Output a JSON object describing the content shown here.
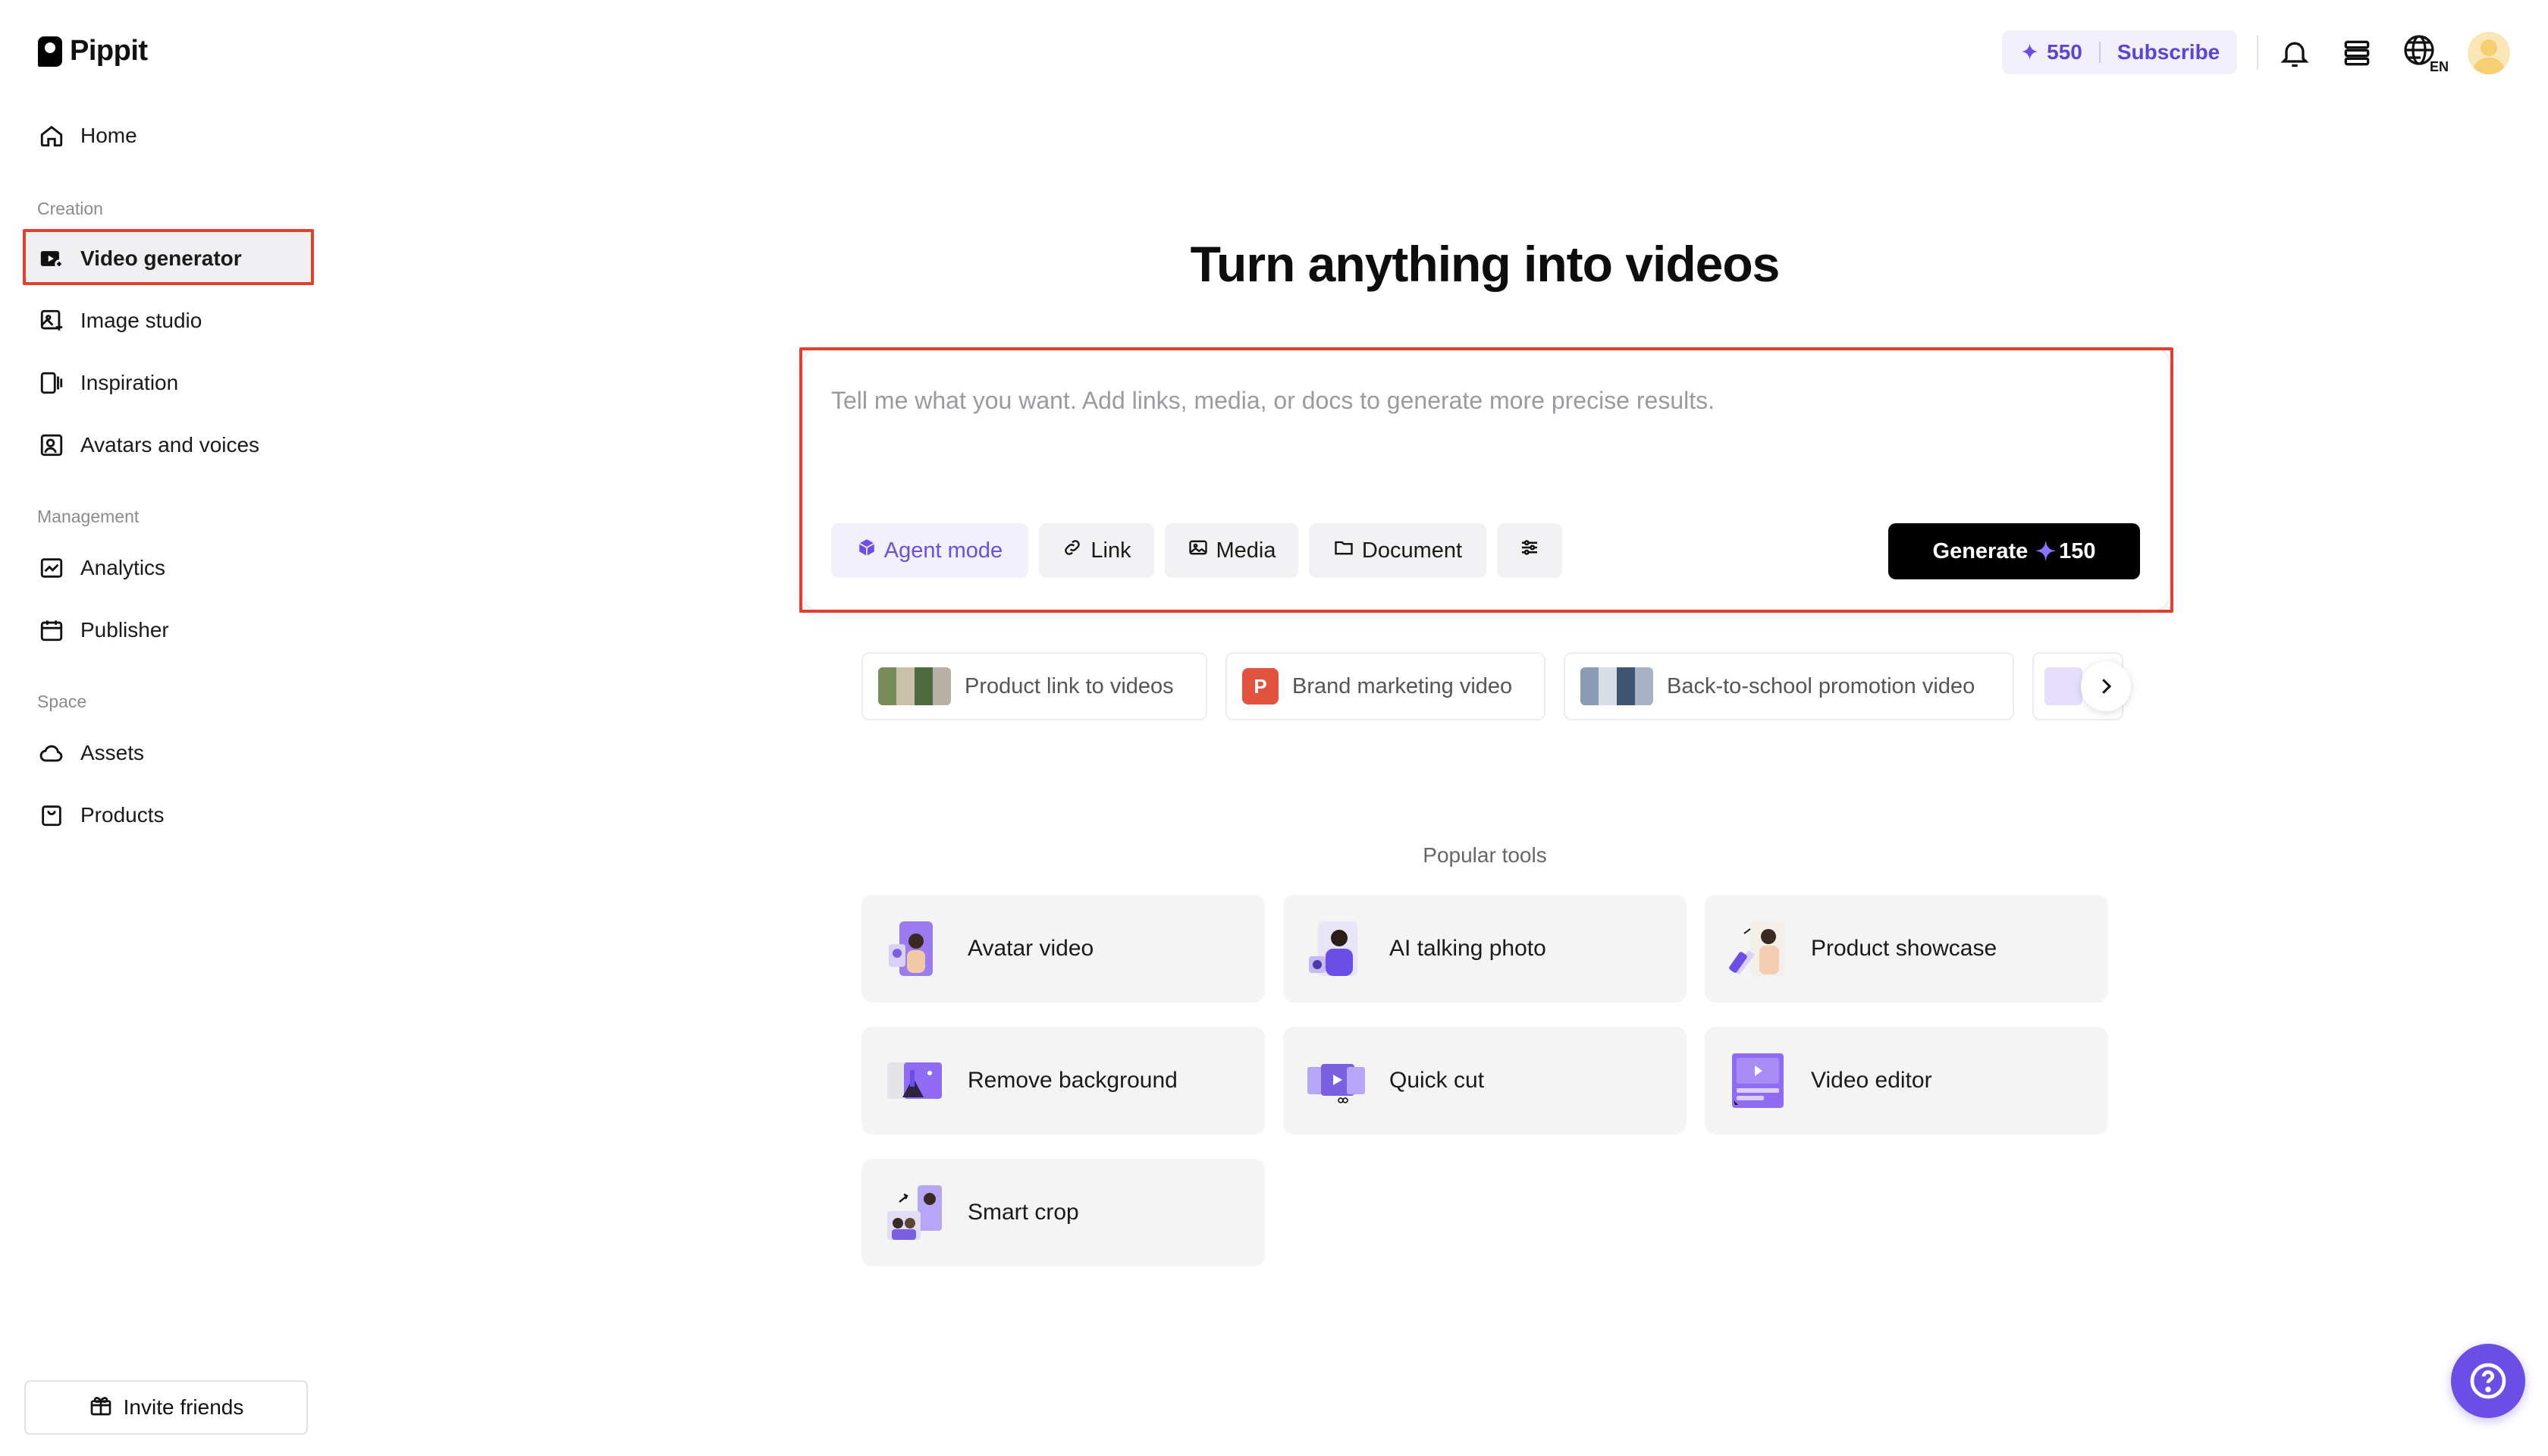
{
  "brand": {
    "name": "Pippit"
  },
  "sidebar": {
    "home": "Home",
    "sections": {
      "creation": "Creation",
      "management": "Management",
      "space": "Space"
    },
    "creation_items": [
      {
        "label": "Video generator",
        "icon": "video-plus-icon"
      },
      {
        "label": "Image studio",
        "icon": "image-plus-icon"
      },
      {
        "label": "Inspiration",
        "icon": "inspiration-icon"
      },
      {
        "label": "Avatars and voices",
        "icon": "avatar-voice-icon"
      }
    ],
    "management_items": [
      {
        "label": "Analytics",
        "icon": "analytics-icon"
      },
      {
        "label": "Publisher",
        "icon": "calendar-icon"
      }
    ],
    "space_items": [
      {
        "label": "Assets",
        "icon": "cloud-icon"
      },
      {
        "label": "Products",
        "icon": "product-box-icon"
      }
    ],
    "invite": "Invite friends"
  },
  "topbar": {
    "credits": "550",
    "subscribe": "Subscribe",
    "language": "EN"
  },
  "hero": {
    "title": "Turn anything into videos",
    "placeholder": "Tell me what you want. Add links, media, or docs to generate more precise results.",
    "chips": {
      "agent": "Agent mode",
      "link": "Link",
      "media": "Media",
      "document": "Document"
    },
    "generate": "Generate",
    "generate_cost": "150"
  },
  "suggestions": [
    {
      "label": "Product link to videos"
    },
    {
      "label": "Brand marketing video",
      "badge": "P"
    },
    {
      "label": "Back-to-school promotion video"
    }
  ],
  "popular": {
    "title": "Popular tools",
    "tools": [
      {
        "label": "Avatar video"
      },
      {
        "label": "AI talking photo"
      },
      {
        "label": "Product showcase"
      },
      {
        "label": "Remove background"
      },
      {
        "label": "Quick cut"
      },
      {
        "label": "Video editor"
      },
      {
        "label": "Smart crop"
      }
    ]
  },
  "colors": {
    "accent": "#6b4ee6",
    "highlight": "#e0402c"
  }
}
